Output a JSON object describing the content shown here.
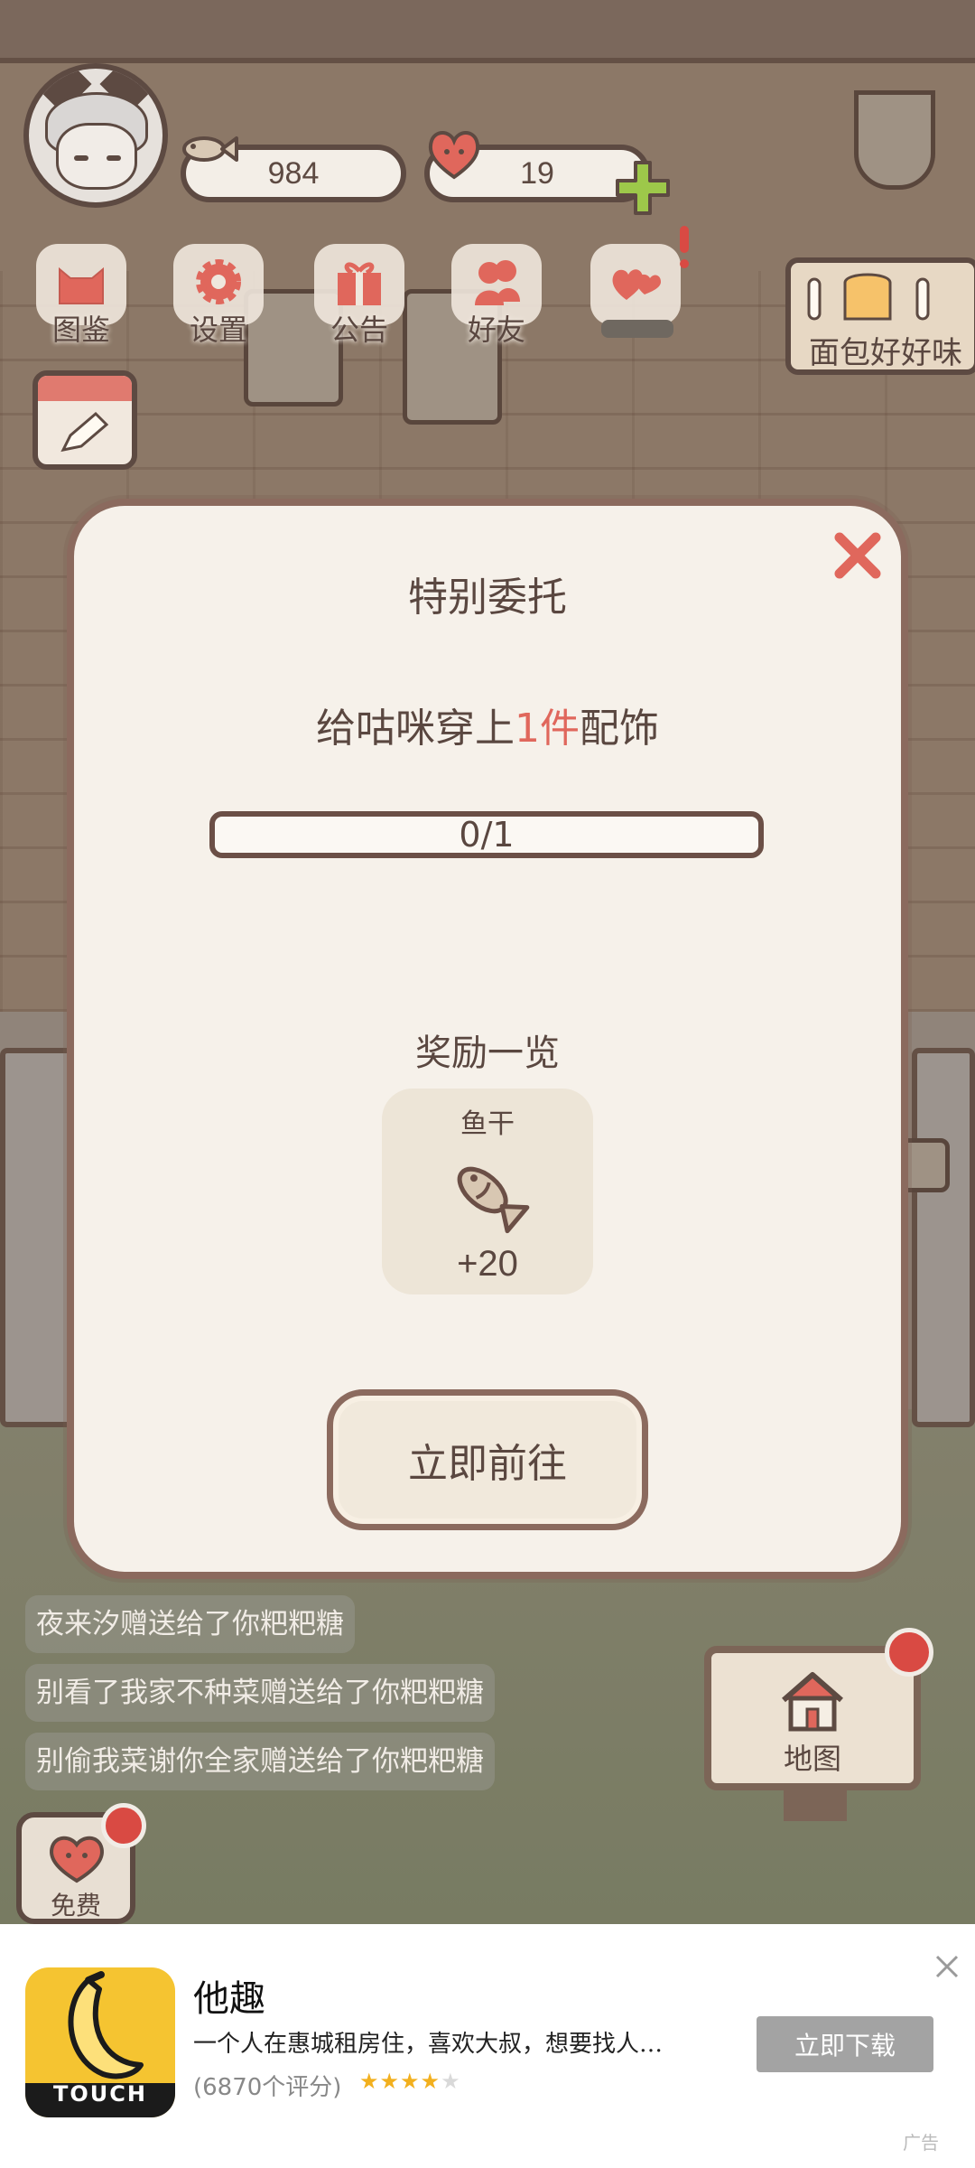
{
  "hud": {
    "fish_count": "984",
    "heart_count": "19",
    "menu": [
      {
        "label": "图鉴"
      },
      {
        "label": "设置"
      },
      {
        "label": "公告"
      },
      {
        "label": "好友"
      }
    ],
    "shop_sign": "面包好好味"
  },
  "dialog": {
    "title": "特别委托",
    "task_prefix": "给咕咪穿上",
    "task_highlight": "1件",
    "task_suffix": "配饰",
    "progress_text": "0/1",
    "progress_fraction": 0,
    "rewards_heading": "奖励一览",
    "reward": {
      "name": "鱼干",
      "amount": "+20",
      "icon": "fish-icon"
    },
    "go_button": "立即前往"
  },
  "gift_log": [
    "夜来汐赠送给了你粑粑糖",
    "别看了我家不种菜赠送给了你粑粑糖",
    "别偷我菜谢你全家赠送给了你粑粑糖"
  ],
  "map_label": "地图",
  "free_label": "免费",
  "ad": {
    "logo_text": "TOUCH",
    "title": "他趣",
    "description": "一个人在惠城租房住，喜欢大叔，想要找人…",
    "rating": "(6870个评分)",
    "stars": 4,
    "button": "立即下载",
    "tag": "广告"
  },
  "colors": {
    "accent_red": "#e0675c",
    "border_brown": "#8b6a5e",
    "panel": "#f6f1ea"
  }
}
